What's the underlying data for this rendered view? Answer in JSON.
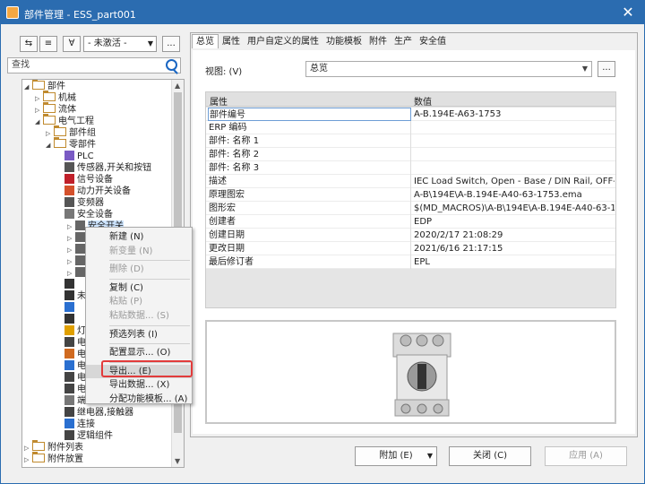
{
  "window": {
    "title": "部件管理 - ESS_part001"
  },
  "toolbar": {
    "filter_value": "- 未激活 -",
    "more_label": "..."
  },
  "search": {
    "placeholder": "查找"
  },
  "tree": [
    {
      "label": "部件",
      "level": 0,
      "kind": "folder",
      "expanded": true
    },
    {
      "label": "机械",
      "level": 1,
      "kind": "folder",
      "expanded": false
    },
    {
      "label": "流体",
      "level": 1,
      "kind": "folder",
      "expanded": false
    },
    {
      "label": "电气工程",
      "level": 1,
      "kind": "folder",
      "expanded": true
    },
    {
      "label": "部件组",
      "level": 2,
      "kind": "folder",
      "expanded": false
    },
    {
      "label": "零部件",
      "level": 2,
      "kind": "folder",
      "expanded": true
    },
    {
      "label": "PLC",
      "level": 3,
      "kind": "plc"
    },
    {
      "label": "传感器,开关和按钮",
      "level": 3,
      "kind": "sensor"
    },
    {
      "label": "信号设备",
      "level": 3,
      "kind": "signal"
    },
    {
      "label": "动力开关设备",
      "level": 3,
      "kind": "power"
    },
    {
      "label": "变频器",
      "level": 3,
      "kind": "vfd"
    },
    {
      "label": "安全设备",
      "level": 3,
      "kind": "safety"
    },
    {
      "label": "安全开关",
      "level": 4,
      "kind": "switch"
    },
    {
      "label": "",
      "level": 4,
      "kind": "switch"
    },
    {
      "label": "",
      "level": 4,
      "kind": "switch"
    },
    {
      "label": "",
      "level": 4,
      "kind": "switch"
    },
    {
      "label": "",
      "level": 4,
      "kind": "switch"
    },
    {
      "label": "",
      "level": 3,
      "kind": "plug"
    },
    {
      "label": "未",
      "level": 3,
      "kind": "question"
    },
    {
      "label": "",
      "level": 3,
      "kind": "misc"
    },
    {
      "label": "",
      "level": 3,
      "kind": "term"
    },
    {
      "label": "灯",
      "level": 3,
      "kind": "lamp"
    },
    {
      "label": "电",
      "level": 3,
      "kind": "cable"
    },
    {
      "label": "电",
      "level": 3,
      "kind": "cable2"
    },
    {
      "label": "电",
      "level": 3,
      "kind": "motor"
    },
    {
      "label": "电",
      "level": 3,
      "kind": "motor2"
    },
    {
      "label": "电",
      "level": 3,
      "kind": "motor3"
    },
    {
      "label": "端子",
      "level": 3,
      "kind": "terminal"
    },
    {
      "label": "继电器,接触器",
      "level": 3,
      "kind": "relay"
    },
    {
      "label": "连接",
      "level": 3,
      "kind": "connect"
    },
    {
      "label": "逻辑组件",
      "level": 3,
      "kind": "logic"
    },
    {
      "label": "附件列表",
      "level": 0,
      "kind": "folder",
      "expanded": false
    },
    {
      "label": "附件放置",
      "level": 0,
      "kind": "folder",
      "expanded": false
    }
  ],
  "context_menu": [
    {
      "label": "新建 (N)",
      "enabled": true
    },
    {
      "label": "新变量 (N)",
      "enabled": false
    },
    {
      "sep": true
    },
    {
      "label": "删除 (D)",
      "enabled": false
    },
    {
      "sep": true
    },
    {
      "label": "复制 (C)",
      "enabled": true
    },
    {
      "label": "粘贴 (P)",
      "enabled": false
    },
    {
      "label": "粘贴数据... (S)",
      "enabled": false
    },
    {
      "sep": true
    },
    {
      "label": "预选列表 (I)",
      "enabled": true
    },
    {
      "sep": true
    },
    {
      "label": "配置显示... (O)",
      "enabled": true
    },
    {
      "sep": true
    },
    {
      "label": "导出... (E)",
      "enabled": true,
      "highlight": true
    },
    {
      "label": "导出数据... (X)",
      "enabled": true
    },
    {
      "label": "分配功能模板... (A)",
      "enabled": true
    }
  ],
  "tabs": [
    "总览",
    "属性",
    "用户自定义的属性",
    "功能模板",
    "附件",
    "生产",
    "安全值"
  ],
  "view": {
    "label": "视图: (V)",
    "value": "总览",
    "more": "..."
  },
  "grid": {
    "headers": [
      "属性",
      "数值"
    ],
    "rows": [
      [
        "部件编号",
        "A-B.194E-A63-1753"
      ],
      [
        "ERP 编码",
        ""
      ],
      [
        "部件: 名称 1",
        ""
      ],
      [
        "部件: 名称 2",
        ""
      ],
      [
        "部件: 名称 3",
        ""
      ],
      [
        "描述",
        "IEC Load Switch, Open - Base / DIN Rail, OFF-ON 9..."
      ],
      [
        "原理图宏",
        "A-B\\194E\\A-B.194E-A40-63-1753.ema"
      ],
      [
        "图形宏",
        "$(MD_MACROS)\\A-B\\194E\\A-B.194E-A40-63-1753..."
      ],
      [
        "创建者",
        "EDP"
      ],
      [
        "创建日期",
        "2020/2/17 21:08:29"
      ],
      [
        "更改日期",
        "2021/6/16 21:17:15"
      ],
      [
        "最后修订者",
        "EPL"
      ]
    ]
  },
  "buttons": {
    "attach": "附加 (E)",
    "close": "关闭 (C)",
    "apply": "应用 (A)"
  },
  "colors": {
    "titlebar": "#2b6cb0",
    "highlight": "#e23b3b"
  }
}
